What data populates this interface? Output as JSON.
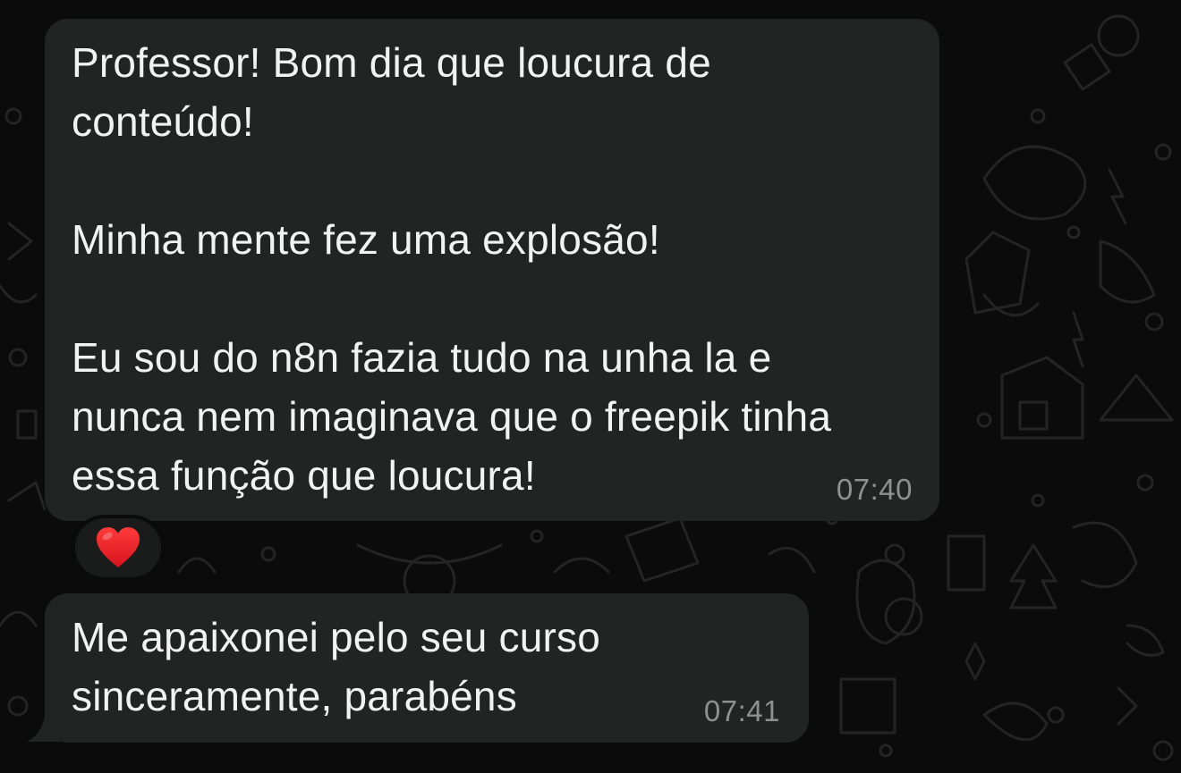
{
  "messages": [
    {
      "text": "Professor! Bom dia que loucura de\nconteúdo!\n\nMinha mente fez uma explosão!\n\nEu sou do n8n fazia tudo na unha la e\nnunca nem imaginava que o freepik tinha\nessa função que loucura!",
      "time": "07:40",
      "reaction": "heart"
    },
    {
      "text": "Me apaixonei pelo seu curso\nsinceramente, parabéns",
      "time": "07:41"
    }
  ],
  "colors": {
    "background": "#0b0b0b",
    "bubble": "#222423",
    "text": "#f2f2f2",
    "timestamp": "#8e9190",
    "heart": "#e8202a"
  }
}
